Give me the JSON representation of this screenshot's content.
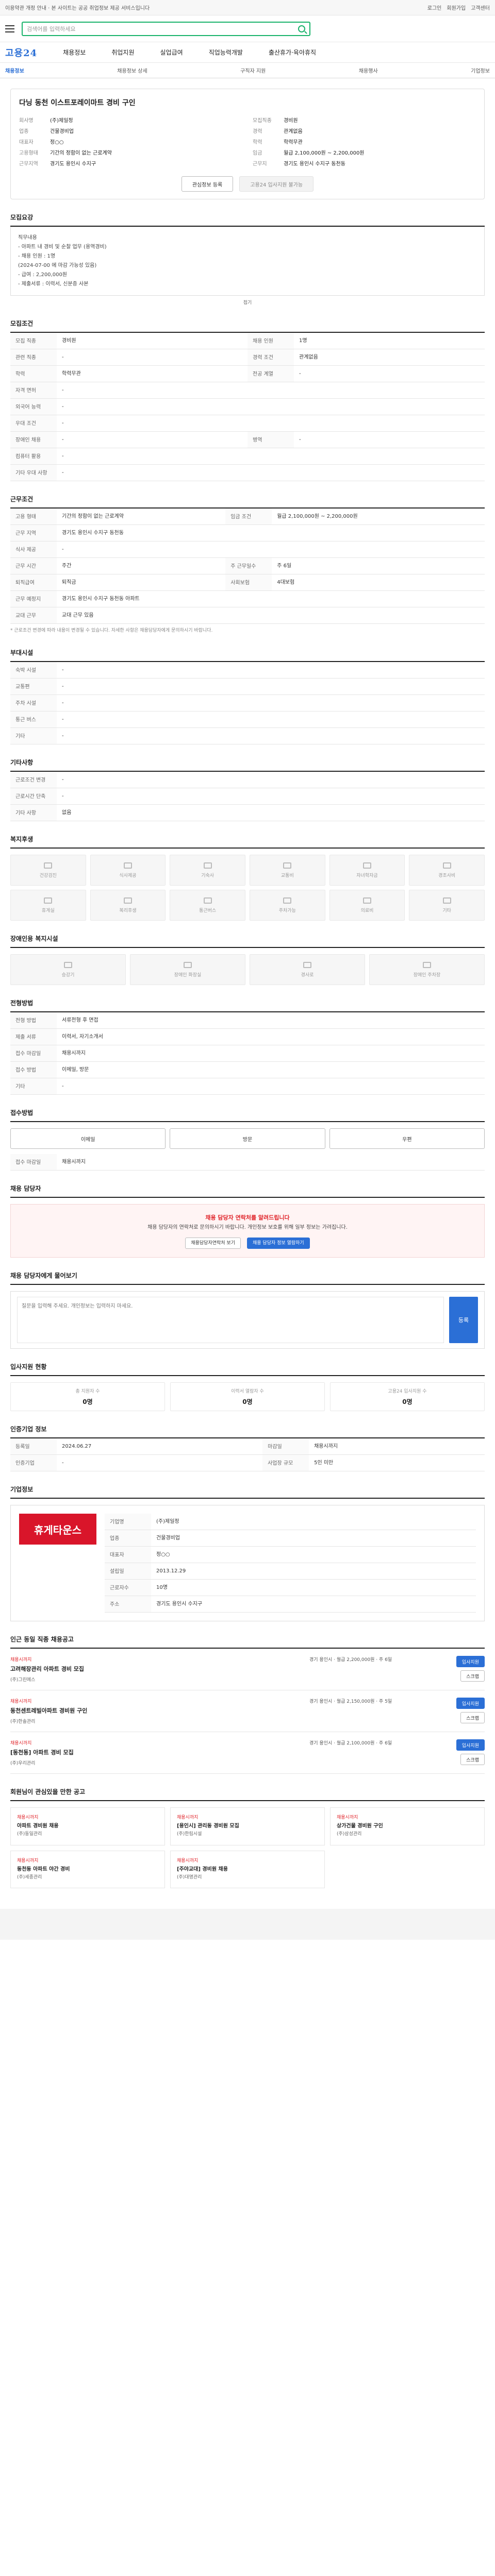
{
  "topbar": {
    "notice": "이용약관 개정 안내 · 본 사이트는 공공 취업정보 제공 서비스입니다",
    "links": [
      "로그인",
      "회원가입",
      "고객센터"
    ]
  },
  "search": {
    "placeholder": "검색어를 입력하세요"
  },
  "logo": "고용24",
  "gnb": [
    "채용정보",
    "취업지원",
    "실업급여",
    "직업능력개발",
    "출산휴가·육아휴직"
  ],
  "subnav": {
    "items": [
      "채용정보",
      "채용정보 상세",
      "구직자 지원",
      "채용행사"
    ],
    "right": "기업정보"
  },
  "job": {
    "title": "다닝 동천 이스트포레이마트 경비 구인",
    "left": [
      [
        "회사명",
        "(주)제일정"
      ],
      [
        "업종",
        "건물경비업"
      ],
      [
        "대표자",
        "정○○"
      ],
      [
        "고용형태",
        "기간의 정함이 없는 근로계약"
      ],
      [
        "근무지역",
        "경기도 용인시 수지구"
      ]
    ],
    "right": [
      [
        "모집직종",
        "경비원"
      ],
      [
        "경력",
        "관계없음"
      ],
      [
        "학력",
        "학력무관"
      ],
      [
        "임금",
        "월급 2,100,000원 ~ 2,200,000원"
      ],
      [
        "근무지",
        "경기도 용인시 수지구 동천동"
      ]
    ],
    "favorite": "관심정보 등록",
    "apply": "고용24 입사지원 불가능"
  },
  "sec_recruit": {
    "title": "모집요강",
    "content": [
      "직무내용",
      "- 아파트 내 경비 및 순찰 업무 (용역경비)",
      "- 채용 인원 : 1명",
      "  (2024-07-00 에 마감 가능성 있음)",
      "- 급여 : 2,200,000원",
      "- 제출서류 : 이력서, 신분증 사본"
    ],
    "fold": "접기"
  },
  "sec_cond": {
    "title": "모집조건",
    "rows": [
      [
        "모집 직종",
        "경비원",
        "채용 인원",
        "1명"
      ],
      [
        "관련 직종",
        "-",
        "경력 조건",
        "관계없음"
      ],
      [
        "학력",
        "학력무관",
        "전공 계열",
        "-"
      ],
      [
        "자격 면허",
        "-",
        "",
        ""
      ],
      [
        "외국어 능력",
        "-",
        "",
        ""
      ],
      [
        "우대 조건",
        "-",
        "",
        ""
      ],
      [
        "장애인 채용",
        "-",
        "병역",
        "-"
      ],
      [
        "컴퓨터 활용",
        "-",
        "",
        ""
      ],
      [
        "기타 우대 사항",
        "-",
        "",
        ""
      ]
    ]
  },
  "sec_work": {
    "title": "근무조건",
    "rows": [
      [
        "고용 형태",
        "기간의 정함이 없는 근로계약",
        "임금 조건",
        "월급 2,100,000원 ~ 2,200,000원"
      ],
      [
        "근무 지역",
        "경기도 용인시 수지구 동천동",
        "",
        ""
      ],
      [
        "식사 제공",
        "-",
        "",
        ""
      ],
      [
        "근무 시간",
        "주간",
        "주 근무일수",
        "주 6일"
      ],
      [
        "퇴직급여",
        "퇴직금",
        "사회보험",
        "4대보험"
      ],
      [
        "근무 예정지",
        "경기도 용인시 수지구 동천동 아파트",
        "",
        ""
      ],
      [
        "교대 근무",
        "교대 근무 있음",
        "",
        ""
      ]
    ],
    "note": "* 근로조건 변경에 따라 내용이 변경될 수 있습니다. 자세한 사항은 채용담당자에게 문의하시기 바랍니다."
  },
  "sec_welfare": {
    "title": "복리후생",
    "label": "복리후생"
  },
  "sec_extra": {
    "title": "부대시설",
    "rows": [
      [
        "숙박 시설",
        "-"
      ],
      [
        "교통편",
        "-"
      ],
      [
        "주차 시설",
        "-"
      ],
      [
        "통근 버스",
        "-"
      ],
      [
        "기타",
        "-"
      ]
    ]
  },
  "sec_other": {
    "title": "기타사항",
    "rows": [
      [
        "근로조건 변경",
        "-"
      ],
      [
        "근로시간 단축",
        "-"
      ],
      [
        "기타 사항",
        "없음"
      ]
    ]
  },
  "sec_facility": {
    "title": "복지후생",
    "items": [
      "건강검진",
      "식사제공",
      "기숙사",
      "교통비",
      "자녀학자금",
      "경조사비",
      "휴게실",
      "복리후생",
      "통근버스",
      "주차가능",
      "의료비",
      "기타"
    ]
  },
  "sec_disabled": {
    "title": "장애인용 복지시설",
    "items": [
      "승강기",
      "장애인 화장실",
      "경사로",
      "장애인 주차장"
    ]
  },
  "sec_process": {
    "title": "전형방법",
    "rows": [
      [
        "전형 방법",
        "서류전형 후 면접"
      ],
      [
        "제출 서류",
        "이력서, 자기소개서"
      ],
      [
        "접수 마감일",
        "채용시까지"
      ],
      [
        "접수 방법",
        "이메일, 방문"
      ],
      [
        "기타",
        "-"
      ]
    ]
  },
  "sec_apply": {
    "title": "접수방법",
    "buttons": [
      "이메일",
      "방문",
      "우편"
    ],
    "deadline": "접수 마감일",
    "deadline_val": "채용시까지"
  },
  "sec_contact": {
    "title": "채용 담당자",
    "alert": "채용 담당자 연락처를 알려드립니다",
    "text": "채용 담당자의 연락처로 문의하시기 바랍니다. 개인정보 보호를 위해 일부 정보는 가려집니다.",
    "btn1": "채용담당자연락처 보기",
    "btn2": "채용 담당자 정보 열람하기"
  },
  "sec_qa": {
    "title": "채용 담당자에게 물어보기",
    "placeholder": "질문을 입력해 주세요. 개인정보는 입력하지 마세요.",
    "submit": "등록"
  },
  "sec_status": {
    "title": "입사지원 현황",
    "cards": [
      [
        "총 지원자 수",
        "0명"
      ],
      [
        "이력서 열람자 수",
        "0명"
      ],
      [
        "고용24 입사지원 수",
        "0명"
      ]
    ]
  },
  "sec_info": {
    "title": "인증기업 정보",
    "rows": [
      [
        "등록일",
        "2024.06.27",
        "마감일",
        "채용시까지"
      ],
      [
        "인증기업",
        "-",
        "사업장 규모",
        "5인 미만"
      ]
    ]
  },
  "sec_company": {
    "title": "기업정보",
    "logo": "휴게타운스",
    "rows": [
      [
        "기업명",
        "(주)제일정"
      ],
      [
        "업종",
        "건물경비업"
      ],
      [
        "대표자",
        "정○○"
      ],
      [
        "설립일",
        "2013.12.29"
      ],
      [
        "근로자수",
        "10명"
      ],
      [
        "주소",
        "경기도 용인시 수지구"
      ]
    ]
  },
  "sec_jobs": {
    "title": "인근 동일 직종 채용공고",
    "items": [
      {
        "status": "채용시까지",
        "title": "고려해장관리 아파트 경비 모집",
        "company": "(주)그린에스",
        "meta": "경기 용인시 · 월급 2,200,000원 · 주 6일"
      },
      {
        "status": "채용시까지",
        "title": "동천센트레빌아파트 경비원 구인",
        "company": "(주)한솔관리",
        "meta": "경기 용인시 · 월급 2,150,000원 · 주 5일"
      },
      {
        "status": "채용시까지",
        "title": "[동천동] 아파트 경비 모집",
        "company": "(주)우리관리",
        "meta": "경기 용인시 · 월급 2,100,000원 · 주 6일"
      }
    ],
    "apply": "입사지원",
    "scrap": "스크랩"
  },
  "sec_rec": {
    "title": "회원님이 관심있을 만한 공고",
    "items": [
      {
        "status": "채용시까지",
        "title": "아파트 경비원 채용",
        "company": "(주)동일관리"
      },
      {
        "status": "채용시까지",
        "title": "[용인시] 관리동 경비원 모집",
        "company": "(주)한림시설"
      },
      {
        "status": "채용시까지",
        "title": "상가건물 경비원 구인",
        "company": "(주)삼성관리"
      },
      {
        "status": "채용시까지",
        "title": "동천동 아파트 야간 경비",
        "company": "(주)세종관리"
      },
      {
        "status": "채용시까지",
        "title": "[주야교대] 경비원 채용",
        "company": "(주)대명관리"
      }
    ]
  }
}
